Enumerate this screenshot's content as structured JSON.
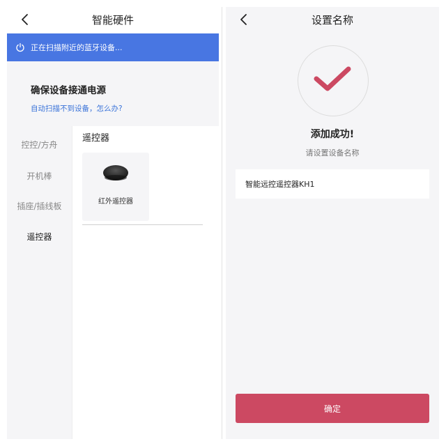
{
  "left": {
    "nav": {
      "title": "智能硬件",
      "back_icon": "chevron-left-icon"
    },
    "scan_bar": {
      "text": "正在扫描附近的蓝牙设备...",
      "icon": "power-icon",
      "color": "#4876e2"
    },
    "tip": {
      "heading": "确保设备接通电源",
      "link": "自动扫描不到设备，怎么办?"
    },
    "categories": [
      {
        "label": "控控/方舟",
        "active": false
      },
      {
        "label": "开机棒",
        "active": false
      },
      {
        "label": "插座/插线板",
        "active": false
      },
      {
        "label": "遥控器",
        "active": true
      }
    ],
    "section_title": "遥控器",
    "devices": [
      {
        "label": "红外遥控器",
        "icon": "ir-remote-device-icon"
      }
    ]
  },
  "right": {
    "nav": {
      "title": "设置名称",
      "back_icon": "chevron-left-icon"
    },
    "check_icon": "checkmark-icon",
    "success_text": "添加成功!",
    "hint_text": "请设置设备名称",
    "name_field": {
      "value": "智能远控遥控器KH1"
    },
    "confirm_label": "确定",
    "accent_color": "#cc4962"
  }
}
